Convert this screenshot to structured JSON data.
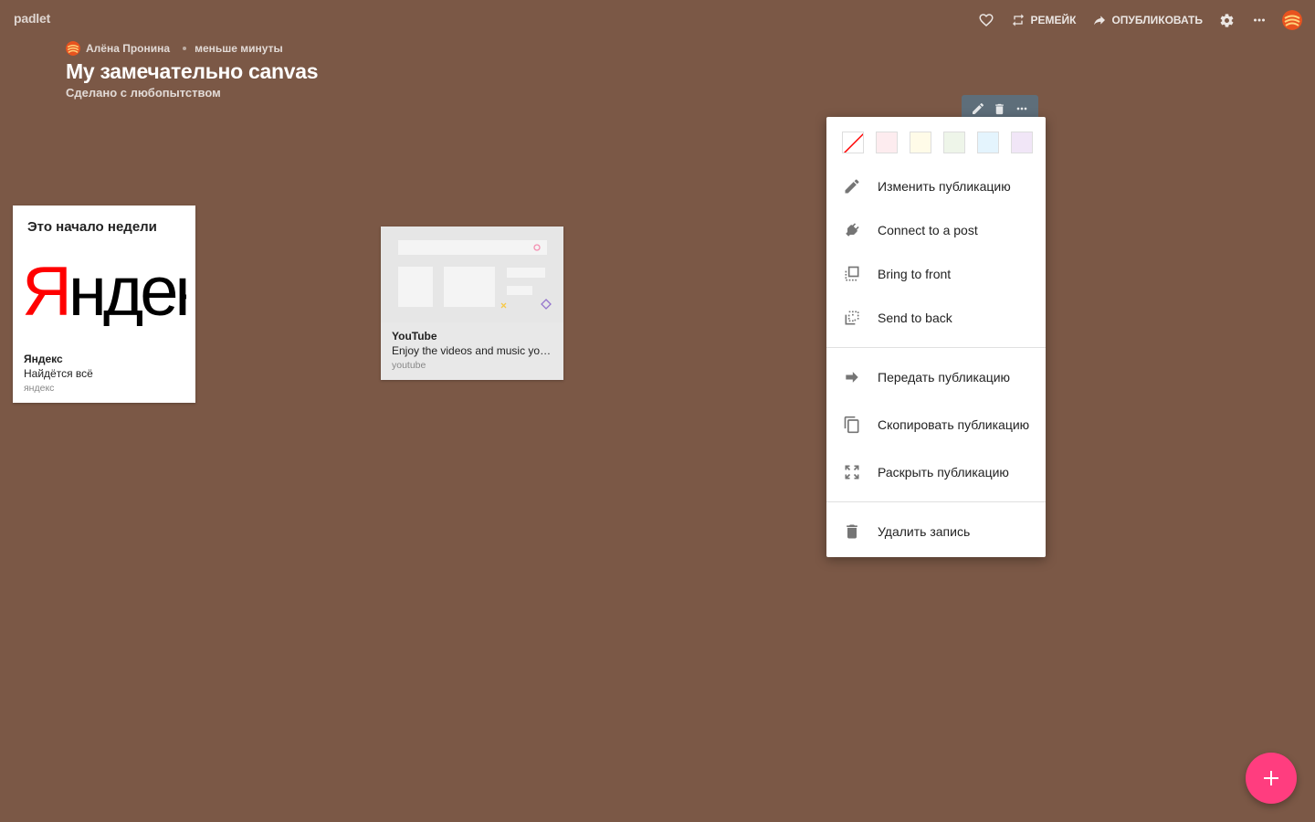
{
  "app": {
    "logo": "padlet"
  },
  "topbar": {
    "like_icon": "heart-icon",
    "remake_label": "РЕМЕЙК",
    "publish_label": "ОПУБЛИКОВАТЬ",
    "settings_icon": "gear-icon",
    "more_icon": "more-horizontal-icon"
  },
  "header": {
    "author": "Алёна Пронина",
    "time": "меньше минуты",
    "title": "My замечательно canvas",
    "subtitle": "Сделано с любопытством"
  },
  "posts": [
    {
      "title": "Это начало недели",
      "image_text": "Яндекс",
      "link_title": "Яндекс",
      "link_desc": "Найдётся всё",
      "link_source": "яндекс"
    },
    {
      "link_title": "YouTube",
      "link_desc": "Enjoy the videos and music you love, upload original content, and share it all with friends",
      "link_source": "youtube"
    }
  ],
  "menu": {
    "swatches": [
      "#ffffff",
      "#fdecef",
      "#fffbe8",
      "#eef5e9",
      "#e4f4fd",
      "#f1e6f7"
    ],
    "items": [
      {
        "label": "Изменить публикацию",
        "icon": "pencil-icon"
      },
      {
        "label": "Connect to a post",
        "icon": "plug-icon"
      },
      {
        "label": "Bring to front",
        "icon": "bring-to-front-icon"
      },
      {
        "label": "Send to back",
        "icon": "send-to-back-icon"
      },
      {
        "label": "Передать публикацию",
        "icon": "arrow-right-icon"
      },
      {
        "label": "Скопировать публикацию",
        "icon": "copy-icon"
      },
      {
        "label": "Раскрыть публикацию",
        "icon": "expand-icon"
      },
      {
        "label": "Удалить запись",
        "icon": "trash-icon"
      }
    ]
  },
  "colors": {
    "background": "#7b5846",
    "fab": "#ff3d7f",
    "toolbar": "#5e6e7a"
  }
}
